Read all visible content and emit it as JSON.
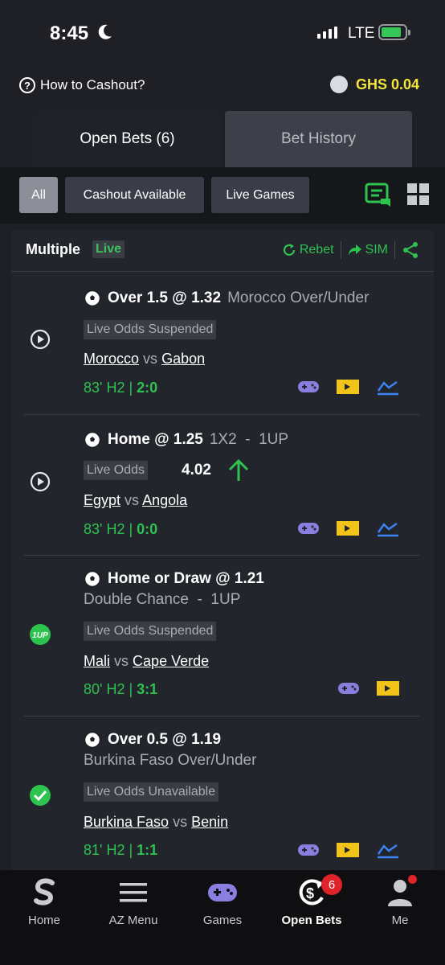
{
  "status_bar": {
    "time": "8:45",
    "network": "LTE"
  },
  "header": {
    "how_to_label": "How to Cashout?",
    "balance": "GHS 0.04"
  },
  "tabs": [
    {
      "label": "Open Bets (6)",
      "active": true
    },
    {
      "label": "Bet History",
      "active": false
    }
  ],
  "filters": [
    {
      "label": "All",
      "active": true
    },
    {
      "label": "Cashout Available",
      "active": false
    },
    {
      "label": "Live Games",
      "active": false
    }
  ],
  "bet": {
    "type_label": "Multiple",
    "live_label": "Live",
    "actions": {
      "rebet": "Rebet",
      "sim": "SIM"
    },
    "legs": [
      {
        "status_icon": "play-icon",
        "selection": "Over 1.5 @ 1.32",
        "market": "Morocco Over/Under",
        "odds_tag": "Live Odds Suspended",
        "home": "Morocco",
        "vs": "vs",
        "away": "Gabon",
        "time": "83' H2 |",
        "score": "2:0",
        "tools": [
          "gamepad-icon",
          "tv-icon",
          "stats-icon"
        ]
      },
      {
        "status_icon": "play-icon",
        "selection": "Home @ 1.25",
        "market": "1X2  -  1UP",
        "odds_tag": "Live Odds",
        "live_odds_value": "4.02",
        "odds_trend": "up-arrow-icon",
        "home": "Egypt",
        "vs": "vs",
        "away": "Angola",
        "time": "83' H2 |",
        "score": "0:0",
        "tools": [
          "gamepad-icon",
          "tv-icon",
          "stats-icon"
        ]
      },
      {
        "status_icon": "1up-badge-icon",
        "status_icon_text": "1UP",
        "selection": "Home or Draw @ 1.21",
        "market": "Double Chance  -  1UP",
        "odds_tag": "Live Odds Suspended",
        "home": "Mali",
        "vs": "vs",
        "away": "Cape Verde",
        "time": "80' H2 |",
        "score": "3:1",
        "tools": [
          "gamepad-icon",
          "tv-icon"
        ]
      },
      {
        "status_icon": "check-circle-icon",
        "selection": "Over 0.5 @ 1.19",
        "market": "Burkina Faso Over/Under",
        "odds_tag": "Live Odds Unavailable",
        "home": "Burkina Faso",
        "vs": "vs",
        "away": "Benin",
        "time": "81' H2 |",
        "score": "1:1",
        "tools": [
          "gamepad-icon",
          "tv-icon",
          "stats-icon"
        ]
      }
    ]
  },
  "nav": [
    {
      "label": "Home",
      "icon": "sportybet-logo-icon"
    },
    {
      "label": "AZ Menu",
      "icon": "hamburger-icon"
    },
    {
      "label": "Games",
      "icon": "gamepad-icon"
    },
    {
      "label": "Open Bets",
      "icon": "cashout-icon",
      "badge": "6",
      "active": true
    },
    {
      "label": "Me",
      "icon": "user-icon"
    }
  ],
  "colors": {
    "accent_green": "#2ec24f",
    "balance_yellow": "#f3e63a",
    "badge_red": "#e0222b",
    "stats_blue": "#3b82f6"
  }
}
